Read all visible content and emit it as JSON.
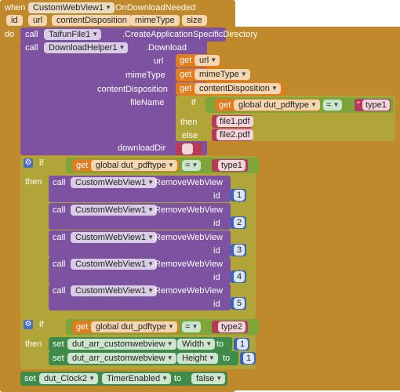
{
  "event": {
    "when": "when",
    "component": "CustomWebView1",
    "event_name": ".OnDownloadNeeded",
    "params": [
      "id",
      "url",
      "contentDisposition",
      "mimeType",
      "size"
    ],
    "do": "do"
  },
  "call_taifun": {
    "call": "call",
    "component": "TaifunFile1",
    "method": ".CreateApplicationSpecificDirectory"
  },
  "call_download": {
    "call": "call",
    "component": "DownloadHelper1",
    "method": ".Download",
    "args": {
      "url": "url",
      "mimeType": "mimeType",
      "contentDisposition": "contentDisposition",
      "fileName": "fileName",
      "downloadDir": "downloadDir"
    },
    "get": "get",
    "get_url": "url",
    "get_mime": "mimeType",
    "get_cd": "contentDisposition",
    "inline_if": {
      "if": "if",
      "then": "then",
      "else": "else",
      "var": "global dut_pdftype",
      "op": "=",
      "cmp": "type1",
      "then_val": "file1.pdf",
      "else_val": "file2.pdf"
    },
    "download_dir_val": ""
  },
  "if1": {
    "if": "if",
    "then": "then",
    "get": "get",
    "var": "global dut_pdftype",
    "op": "=",
    "cmp": "type1",
    "calls": [
      {
        "call": "call",
        "component": "CustomWebView1",
        "method": ".RemoveWebView",
        "arg": "id",
        "value": "1"
      },
      {
        "call": "call",
        "component": "CustomWebView1",
        "method": ".RemoveWebView",
        "arg": "id",
        "value": "2"
      },
      {
        "call": "call",
        "component": "CustomWebView1",
        "method": ".RemoveWebView",
        "arg": "id",
        "value": "3"
      },
      {
        "call": "call",
        "component": "CustomWebView1",
        "method": ".RemoveWebView",
        "arg": "id",
        "value": "4"
      },
      {
        "call": "call",
        "component": "CustomWebView1",
        "method": ".RemoveWebView",
        "arg": "id",
        "value": "5"
      }
    ]
  },
  "if2": {
    "if": "if",
    "then": "then",
    "get": "get",
    "var": "global dut_pdftype",
    "op": "=",
    "cmp": "type2",
    "sets": [
      {
        "set": "set",
        "component": "dut_arr_customwebview",
        "prop": "Width",
        "to": "to",
        "value": "1"
      },
      {
        "set": "set",
        "component": "dut_arr_customwebview",
        "prop": "Height",
        "to": "to",
        "value": "1"
      }
    ]
  },
  "set_clock": {
    "set": "set",
    "component": "dut_Clock2",
    "prop": "TimerEnabled",
    "to": "to",
    "value": "false"
  },
  "colors": {
    "event": "#c08a2c",
    "procedure": "#7c52a1",
    "control": "#b1a53a",
    "getter": "#e07d1f",
    "text": "#b83a5a",
    "number": "#3a66b8",
    "setter": "#3e8b4a"
  },
  "icons": {
    "dropdown": "▼",
    "gear": "⚙"
  }
}
